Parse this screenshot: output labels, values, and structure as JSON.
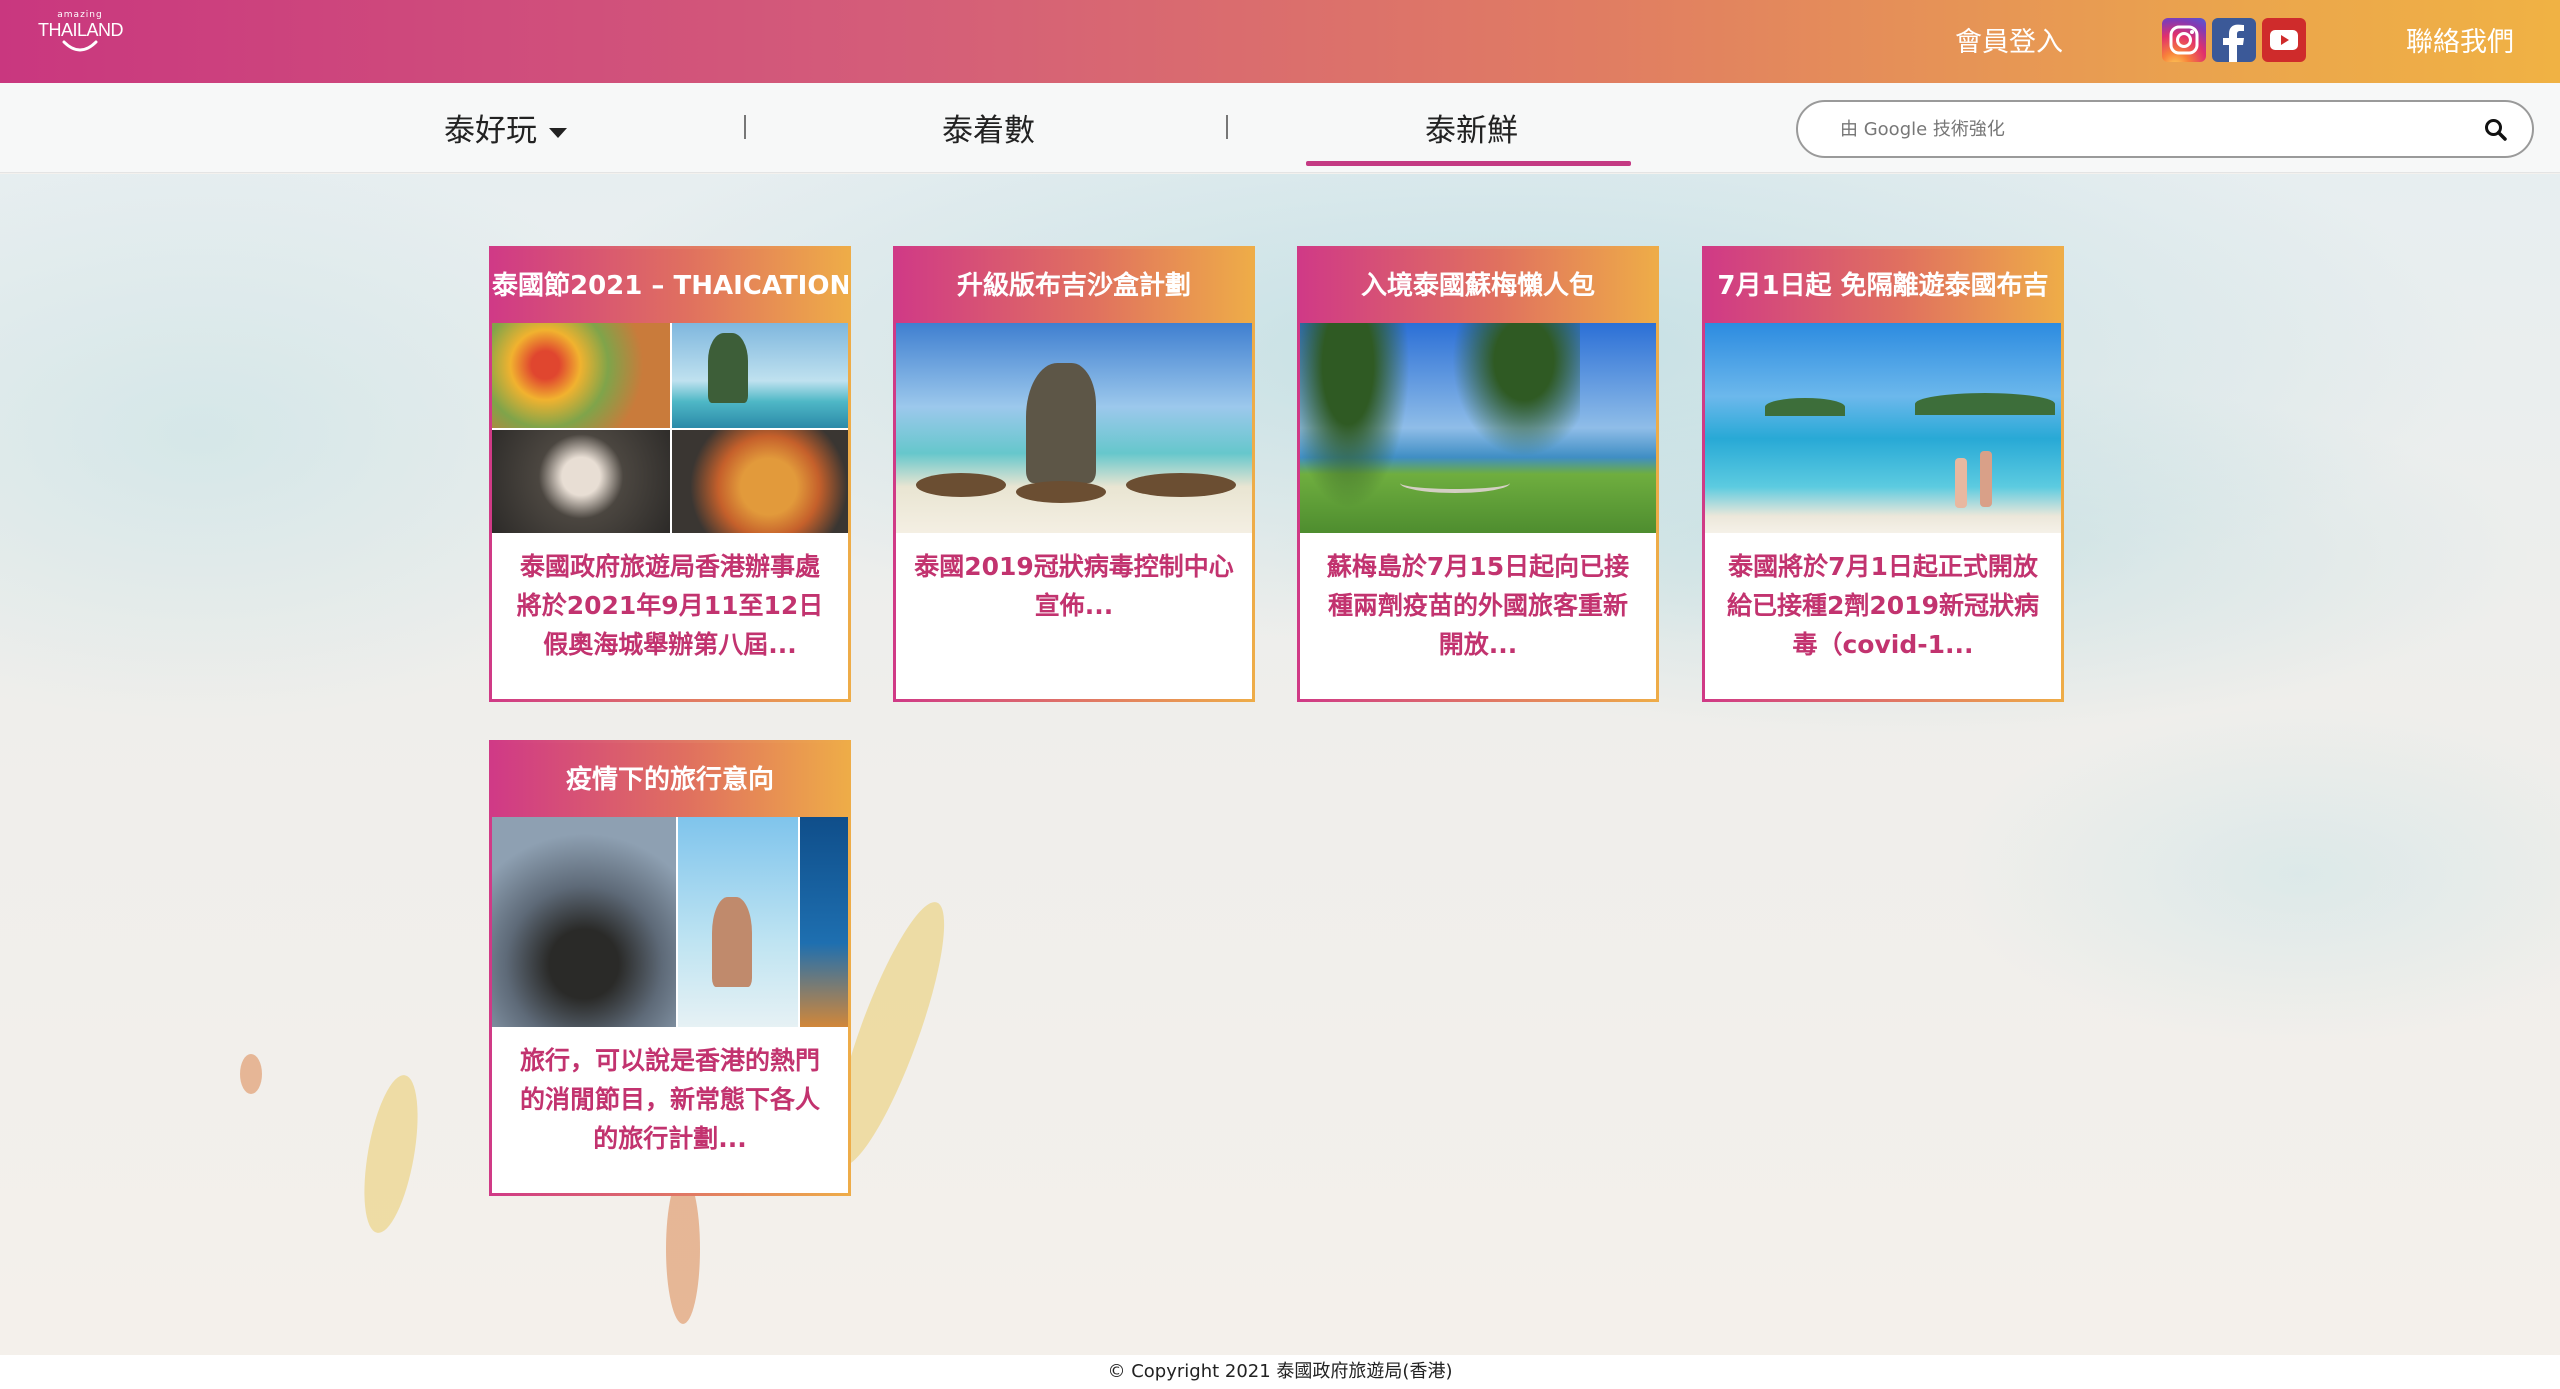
{
  "header": {
    "logo_tag": "amazing",
    "logo_word": "THAILAND",
    "login_label": "會員登入",
    "contact_label": "聯絡我們",
    "social": [
      "instagram-icon",
      "facebook-icon",
      "youtube-icon"
    ]
  },
  "nav": {
    "items": [
      {
        "label": "泰好玩",
        "has_dropdown": true
      },
      {
        "label": "泰着數"
      },
      {
        "label": "泰新鮮",
        "active": true
      }
    ],
    "active_color": "#c43a83"
  },
  "search": {
    "placeholder": "由 Google 技術強化"
  },
  "colors": {
    "gradient_start": "#c9377f",
    "gradient_end": "#f0b244",
    "card_text": "#c2336f"
  },
  "cards": [
    {
      "title": "泰國節2021 – THAICATION",
      "excerpt": "泰國政府旅遊局香港辦事處將於2021年9月11至12日假奧海城舉辦第八屆..."
    },
    {
      "title": "升級版布吉沙盒計劃",
      "excerpt": "泰國2019冠狀病毒控制中心宣佈..."
    },
    {
      "title": "入境泰國蘇梅懶人包",
      "excerpt": "蘇梅島於7月15日起向已接種兩劑疫苗的外國旅客重新開放..."
    },
    {
      "title": "7月1日起 免隔離遊泰國布吉",
      "excerpt": "泰國將於7月1日起正式開放給已接種2劑2019新冠狀病毒（covid-1..."
    },
    {
      "title": "疫情下的旅行意向",
      "excerpt": "旅行，可以說是香港的熱門的消閒節目，新常態下各人的旅行計劃..."
    }
  ],
  "footer": {
    "copyright": "© Copyright 2021 泰國政府旅遊局(香港)"
  }
}
